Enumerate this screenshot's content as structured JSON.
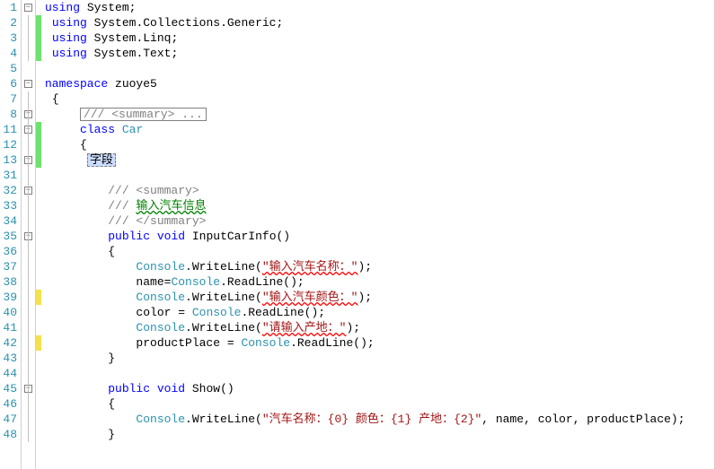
{
  "line_numbers": [
    "1",
    "2",
    "3",
    "4",
    "5",
    "6",
    "7",
    "8",
    "11",
    "12",
    "13",
    "31",
    "32",
    "33",
    "34",
    "35",
    "36",
    "37",
    "38",
    "39",
    "40",
    "41",
    "42",
    "43",
    "44",
    "45",
    "46",
    "47",
    "48"
  ],
  "fold": {
    "l1": "minus",
    "l6": "minus",
    "l8": "plus",
    "l11": "minus",
    "l13": "plus",
    "l32": "minus",
    "l35": "minus",
    "l45": "minus"
  },
  "indicators": {
    "l2": "green",
    "l3": "green",
    "l4": "green",
    "l11": "green",
    "l12": "green",
    "l13": "green",
    "l39": "yellow",
    "l42": "yellow"
  },
  "code": {
    "l1": {
      "kw": "using",
      "sp": " ",
      "id": "System",
      "p": ";"
    },
    "l2": {
      "kw": "using",
      "sp": " ",
      "id": "System.Collections.Generic",
      "p": ";"
    },
    "l3": {
      "kw": "using",
      "sp": " ",
      "id": "System.Linq",
      "p": ";"
    },
    "l4": {
      "kw": "using",
      "sp": " ",
      "id": "System.Text",
      "p": ";"
    },
    "l6": {
      "kw": "namespace",
      "sp": " ",
      "id": "zuoye5"
    },
    "l7": {
      "p": "{"
    },
    "l8": {
      "box": "/// <summary> ..."
    },
    "l11": {
      "kw": "class",
      "sp": " ",
      "type": "Car"
    },
    "l12": {
      "p": "{"
    },
    "l13": {
      "sel": "字段"
    },
    "l32": {
      "c": "/// <summary>"
    },
    "l33_a": "/// ",
    "l33_b": "输入汽车信息",
    "l34": {
      "c": "/// </summary>"
    },
    "l35": {
      "kw1": "public",
      "kw2": "void",
      "id": "InputCarInfo",
      "p": "()"
    },
    "l36": {
      "p": "{"
    },
    "l37": {
      "type": "Console",
      "m": ".WriteLine(",
      "s": "\"输入汽车名称：\"",
      "e": ");"
    },
    "l38": {
      "id": "name",
      "eq": "=",
      "type": "Console",
      "m": ".ReadLine();"
    },
    "l39": {
      "type": "Console",
      "m": ".WriteLine(",
      "s": "\"输入汽车颜色：\"",
      "e": ");"
    },
    "l40": {
      "id": "color = ",
      "type": "Console",
      "m": ".ReadLine();"
    },
    "l41": {
      "type": "Console",
      "m": ".WriteLine(",
      "s": "\"请输入产地：\"",
      "e": ");"
    },
    "l42": {
      "id": "productPlace = ",
      "type": "Console",
      "m": ".ReadLine();"
    },
    "l43": {
      "p": "}"
    },
    "l45": {
      "kw1": "public",
      "kw2": "void",
      "id": "Show",
      "p": "()"
    },
    "l46": {
      "p": "{"
    },
    "l47": {
      "type": "Console",
      "m": ".WriteLine(",
      "s": "\"汽车名称：{0} 颜色：{1} 产地：{2}\"",
      "args": ", name, color, productPlace);"
    },
    "l48": {
      "p": "}"
    }
  }
}
